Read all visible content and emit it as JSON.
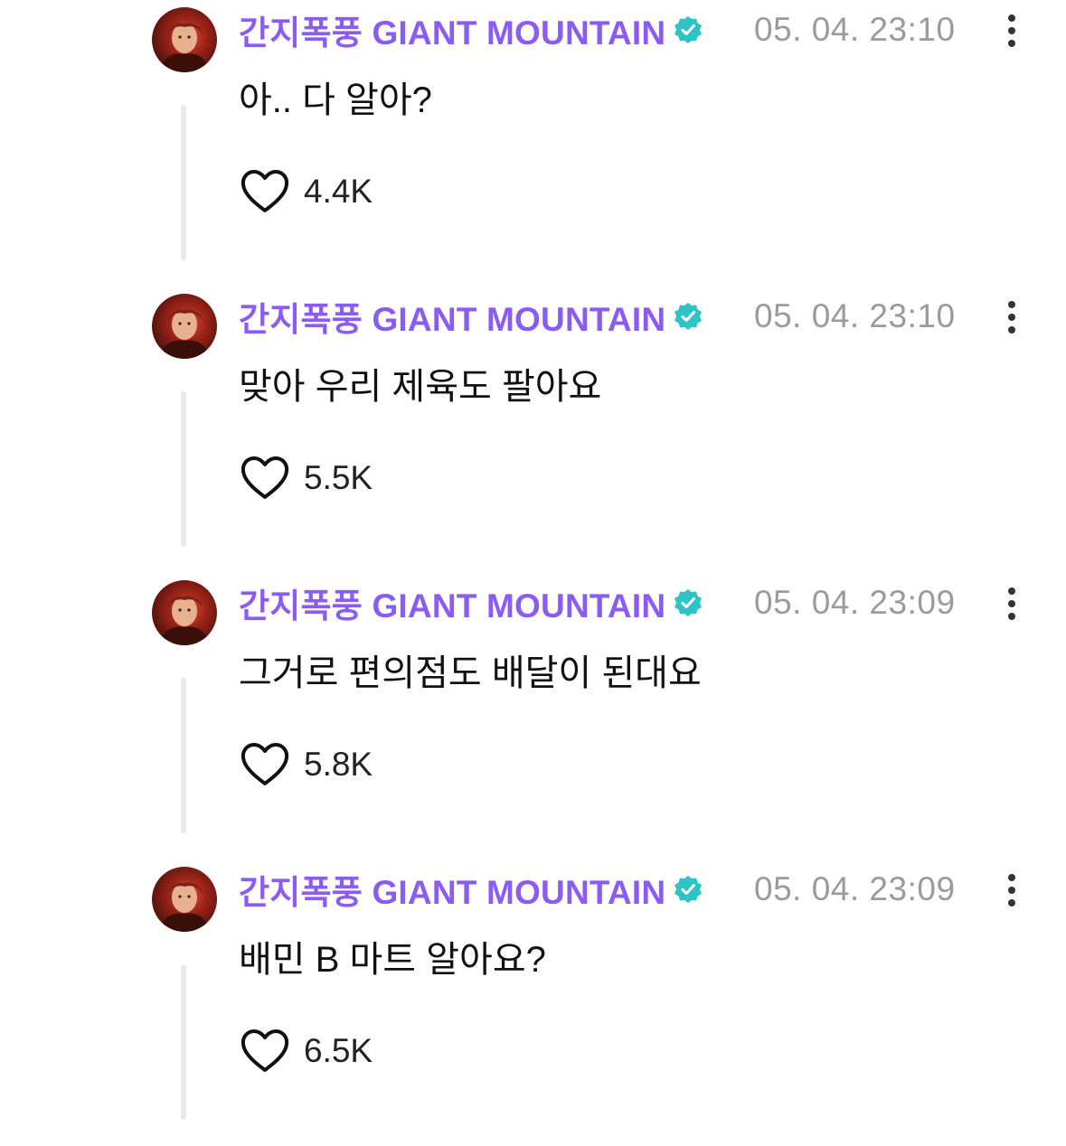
{
  "colors": {
    "username": "#8a5cf5",
    "verified_badge": "#2ec4c7",
    "timestamp": "#9a9a9f",
    "thread_line": "#e9e9ec",
    "text": "#111111"
  },
  "icons": {
    "verified": "verified-badge-icon",
    "more": "more-vertical-icon",
    "like": "heart-outline-icon"
  },
  "comments": [
    {
      "username": "간지폭풍 GIANT MOUNTAIN",
      "timestamp": "05. 04. 23:10",
      "text": "아.. 다 알아?",
      "likes": "4.4K"
    },
    {
      "username": "간지폭풍 GIANT MOUNTAIN",
      "timestamp": "05. 04. 23:10",
      "text": "맞아 우리 제육도 팔아요",
      "likes": "5.5K"
    },
    {
      "username": "간지폭풍 GIANT MOUNTAIN",
      "timestamp": "05. 04. 23:09",
      "text": "그거로 편의점도 배달이 된대요",
      "likes": "5.8K"
    },
    {
      "username": "간지폭풍 GIANT MOUNTAIN",
      "timestamp": "05. 04. 23:09",
      "text": "배민 B 마트 알아요?",
      "likes": "6.5K"
    }
  ]
}
